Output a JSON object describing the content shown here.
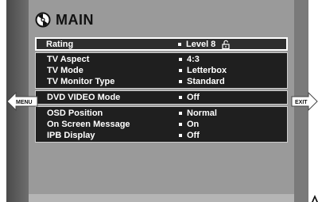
{
  "header": {
    "title": "MAIN",
    "icon": "disc-icon"
  },
  "menu": {
    "items": [
      {
        "label": "Rating",
        "value": "Level  8",
        "icon": "unlock-icon"
      },
      {
        "label": "TV Aspect",
        "value": "4:3"
      },
      {
        "label": "TV Mode",
        "value": "Letterbox"
      },
      {
        "label": "TV Monitor Type",
        "value": "Standard"
      },
      {
        "label": "DVD VIDEO Mode",
        "value": "Off"
      },
      {
        "label": "OSD  Position",
        "value": "Normal"
      },
      {
        "label": "On Screen Message",
        "value": "On"
      },
      {
        "label": "IPB Display",
        "value": "Off"
      }
    ]
  },
  "nav": {
    "menu_label": "MENU",
    "exit_label": "EXIT"
  },
  "colors": {
    "panel": "#9a9a9a",
    "list_background": "#1f1f1f",
    "bezel": "#5f5f5f",
    "text": "#ffffff"
  }
}
